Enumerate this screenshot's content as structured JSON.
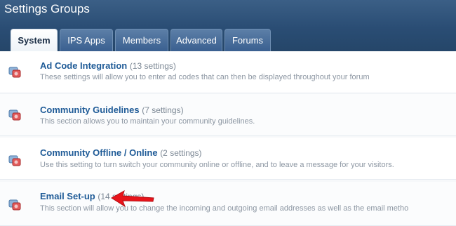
{
  "header": {
    "title": "Settings Groups"
  },
  "tabs": [
    {
      "label": "System",
      "active": true
    },
    {
      "label": "IPS Apps",
      "active": false
    },
    {
      "label": "Members",
      "active": false
    },
    {
      "label": "Advanced",
      "active": false
    },
    {
      "label": "Forums",
      "active": false
    }
  ],
  "groups": [
    {
      "title": "Ad Code Integration",
      "count": "(13 settings)",
      "description": "These settings will allow you to enter ad codes that can then be displayed throughout your forum",
      "icon": "settings-group-icon"
    },
    {
      "title": "Community Guidelines",
      "count": "(7 settings)",
      "description": "This section allows you to maintain your community guidelines.",
      "icon": "settings-group-icon"
    },
    {
      "title": "Community Offline / Online",
      "count": "(2 settings)",
      "description": "Use this setting to turn switch your community online or offline, and to leave a message for your visitors.",
      "icon": "settings-group-icon"
    },
    {
      "title": "Email Set-up",
      "count": "(14 settings)",
      "description": "This section will allow you to change the incoming and outgoing email addresses as well as the email metho",
      "icon": "settings-group-icon"
    }
  ],
  "annotation": {
    "icon": "red-arrow-icon",
    "color": "#e8141b"
  },
  "colors": {
    "header": "#2c4f77",
    "link": "#1f5b97",
    "muted": "#8d97a3"
  }
}
